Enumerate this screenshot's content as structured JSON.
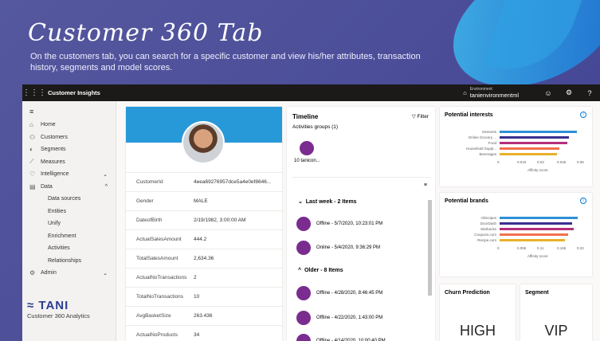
{
  "hero": {
    "title": "Customer 360 Tab",
    "subtitle": "On the customers tab, you can search for a specific customer and view his/her attributes, transaction history, segments and model scores."
  },
  "topbar": {
    "app_title": "Customer Insights",
    "env_label": "Environment",
    "env_name": "tanienvironmentml"
  },
  "sidebar": {
    "items": [
      {
        "label": "Home",
        "icon": "home-icon"
      },
      {
        "label": "Customers",
        "icon": "people-icon"
      },
      {
        "label": "Segments",
        "icon": "segments-icon"
      },
      {
        "label": "Measures",
        "icon": "measures-icon"
      },
      {
        "label": "Intelligence",
        "icon": "bulb-icon"
      },
      {
        "label": "Data",
        "icon": "data-icon"
      }
    ],
    "data_sub": [
      "Data sources",
      "Entities",
      "Unify",
      "Enrichment",
      "Activities",
      "Relationships"
    ],
    "admin": "Admin"
  },
  "logo": {
    "name": "TANI",
    "tagline": "Customer 360 Analytics"
  },
  "profile": {
    "attributes": [
      {
        "k": "CustomerId",
        "v": "4eea69276957dce5a4e0ef8646..."
      },
      {
        "k": "Gender",
        "v": "MALE"
      },
      {
        "k": "DateofBirth",
        "v": "2/19/1982, 3:00:00 AM"
      },
      {
        "k": "ActualSalesAmount",
        "v": "444.2"
      },
      {
        "k": "TotalSalesAmount",
        "v": "2,634.36"
      },
      {
        "k": "ActualNoTransactions",
        "v": "2"
      },
      {
        "k": "TotalNoTransactions",
        "v": "10"
      },
      {
        "k": "AvgBasketSize",
        "v": "263.436"
      },
      {
        "k": "ActualNoProducts",
        "v": "34"
      }
    ]
  },
  "timeline": {
    "title": "Timeline",
    "filter": "Filter",
    "groups_label": "Activities groups (1)",
    "group_name": "10 tanicon...",
    "sections": [
      "Last week - 2 Items",
      "Older - 8 Items"
    ],
    "items": [
      "Offline - 5/7/2020, 10:23:01 PM",
      "Online - 5/4/2020, 9:36:29 PM",
      "Offline - 4/28/2020, 8:46:45 PM",
      "Offline - 4/22/2020, 1:43:00 PM",
      "Offline - 4/14/2020, 10:00:40 PM"
    ]
  },
  "interests": {
    "title": "Potential interests",
    "axis_label": "Affinity score",
    "ticks": [
      "0",
      "0.015",
      "0.03",
      "0.045",
      "0.06"
    ],
    "bars": [
      {
        "label": "Desserts",
        "value": 0.058,
        "color": "#2f8fd6"
      },
      {
        "label": "Online Grocery ...",
        "value": 0.052,
        "color": "#3a2f8f"
      },
      {
        "label": "Food",
        "value": 0.051,
        "color": "#b42e7a"
      },
      {
        "label": "Household Suppl...",
        "value": 0.045,
        "color": "#f2714e"
      },
      {
        "label": "Beverages",
        "value": 0.043,
        "color": "#e9b02a"
      }
    ],
    "max": 0.06
  },
  "brands": {
    "title": "Potential brands",
    "axis_label": "Affinity score",
    "ticks": [
      "0",
      "0.055",
      "0.11",
      "0.165",
      "0.22"
    ],
    "bars": [
      {
        "label": "Allrecipes",
        "value": 0.215,
        "color": "#2f8fd6"
      },
      {
        "label": "DoorDash",
        "value": 0.2,
        "color": "#3a2f8f"
      },
      {
        "label": "Starbucks",
        "value": 0.205,
        "color": "#b42e7a"
      },
      {
        "label": "Coupons.com",
        "value": 0.19,
        "color": "#f2714e"
      },
      {
        "label": "Recipe.com",
        "value": 0.18,
        "color": "#e9b02a"
      }
    ],
    "max": 0.22
  },
  "churn": {
    "title": "Churn Prediction",
    "value": "HIGH"
  },
  "segment": {
    "title": "Segment",
    "value": "VIP"
  }
}
